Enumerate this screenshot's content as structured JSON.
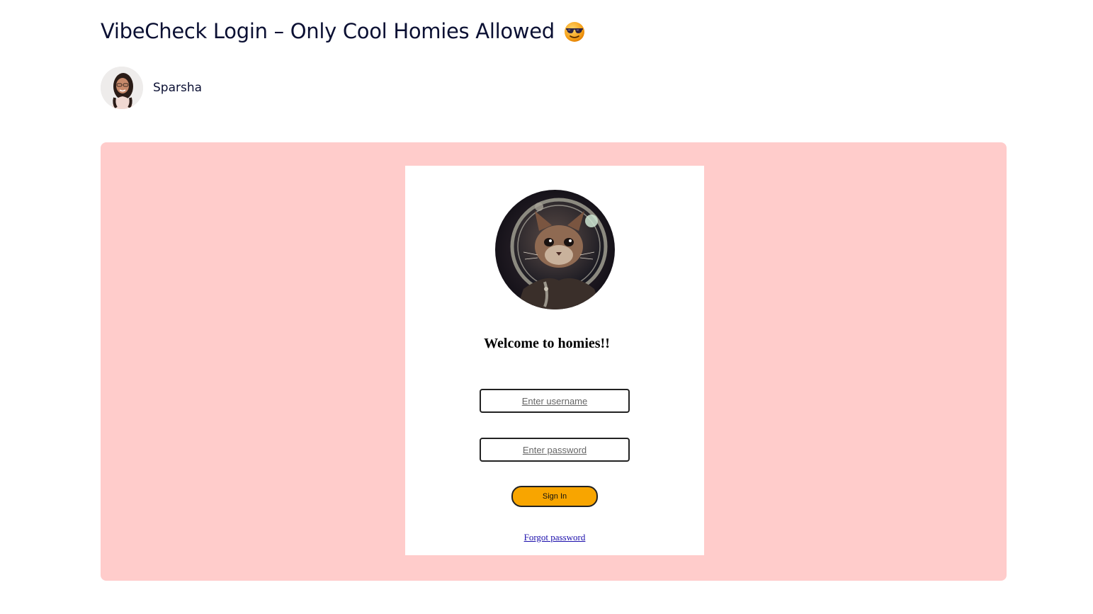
{
  "post": {
    "title": "VibeCheck Login – Only Cool Homies Allowed",
    "title_emoji": "smiling-face-with-sunglasses-icon"
  },
  "author": {
    "name": "Sparsha",
    "avatar": "author-avatar"
  },
  "stage": {
    "background": "#ffcccb"
  },
  "login": {
    "avatar": "astronaut-cat-avatar",
    "welcome": "Welcome to homies!!",
    "username_placeholder": "Enter username",
    "password_placeholder": "Enter password",
    "signin_label": "Sign In",
    "signin_color": "#f8a500",
    "forgot_label": "Forgot password"
  }
}
